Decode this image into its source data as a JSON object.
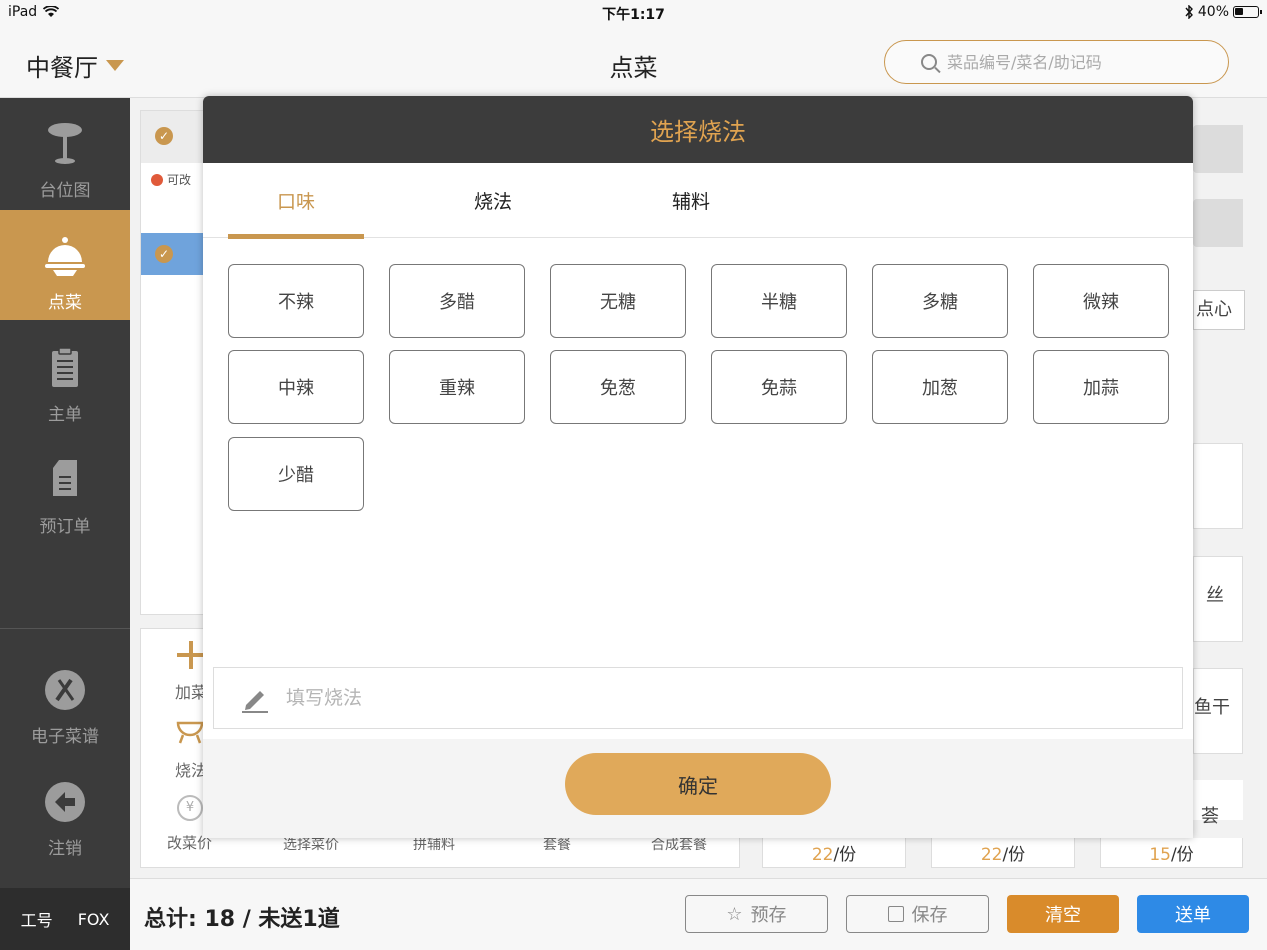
{
  "status_bar": {
    "device": "iPad",
    "time": "下午1:17",
    "battery": "40%",
    "battery_level": 0.4
  },
  "header": {
    "venue": "中餐厅",
    "title": "点菜",
    "search_placeholder": "菜品编号/菜名/助记码"
  },
  "sidebar": {
    "items": [
      {
        "label": "台位图",
        "icon": "table-icon"
      },
      {
        "label": "点菜",
        "icon": "cloche-icon",
        "active": true
      },
      {
        "label": "主单",
        "icon": "clipboard-icon"
      },
      {
        "label": "预订单",
        "icon": "document-icon"
      },
      {
        "label": "电子菜谱",
        "icon": "cutlery-icon"
      },
      {
        "label": "注销",
        "icon": "logout-icon"
      }
    ],
    "staff_label": "工号",
    "staff_id": "FOX"
  },
  "background": {
    "order_hint": "可改",
    "action_labels": [
      "加菜",
      "烧法",
      "改菜价",
      "选择菜价",
      "拼辅料",
      "套餐",
      "合成套餐"
    ],
    "side_fragments": [
      "点心",
      "丝",
      "鱼干",
      "荟"
    ],
    "prices": [
      "22",
      "22",
      "15"
    ],
    "price_unit": "/份"
  },
  "bottom_bar": {
    "total": "总计: 18 / 未送1道",
    "buttons": {
      "prestore": "预存",
      "save": "保存",
      "clear": "清空",
      "send": "送单"
    }
  },
  "modal": {
    "title": "选择烧法",
    "tabs": [
      "口味",
      "烧法",
      "辅料"
    ],
    "active_tab": "口味",
    "options": [
      "不辣",
      "多醋",
      "无糖",
      "半糖",
      "多糖",
      "微辣",
      "中辣",
      "重辣",
      "免葱",
      "免蒜",
      "加葱",
      "加蒜",
      "少醋"
    ],
    "note_placeholder": "填写烧法",
    "confirm": "确定"
  },
  "colors": {
    "accent": "#c9974f",
    "sidebar": "#3b3b3b",
    "clear": "#d98b2b",
    "send": "#2e8ae6"
  }
}
